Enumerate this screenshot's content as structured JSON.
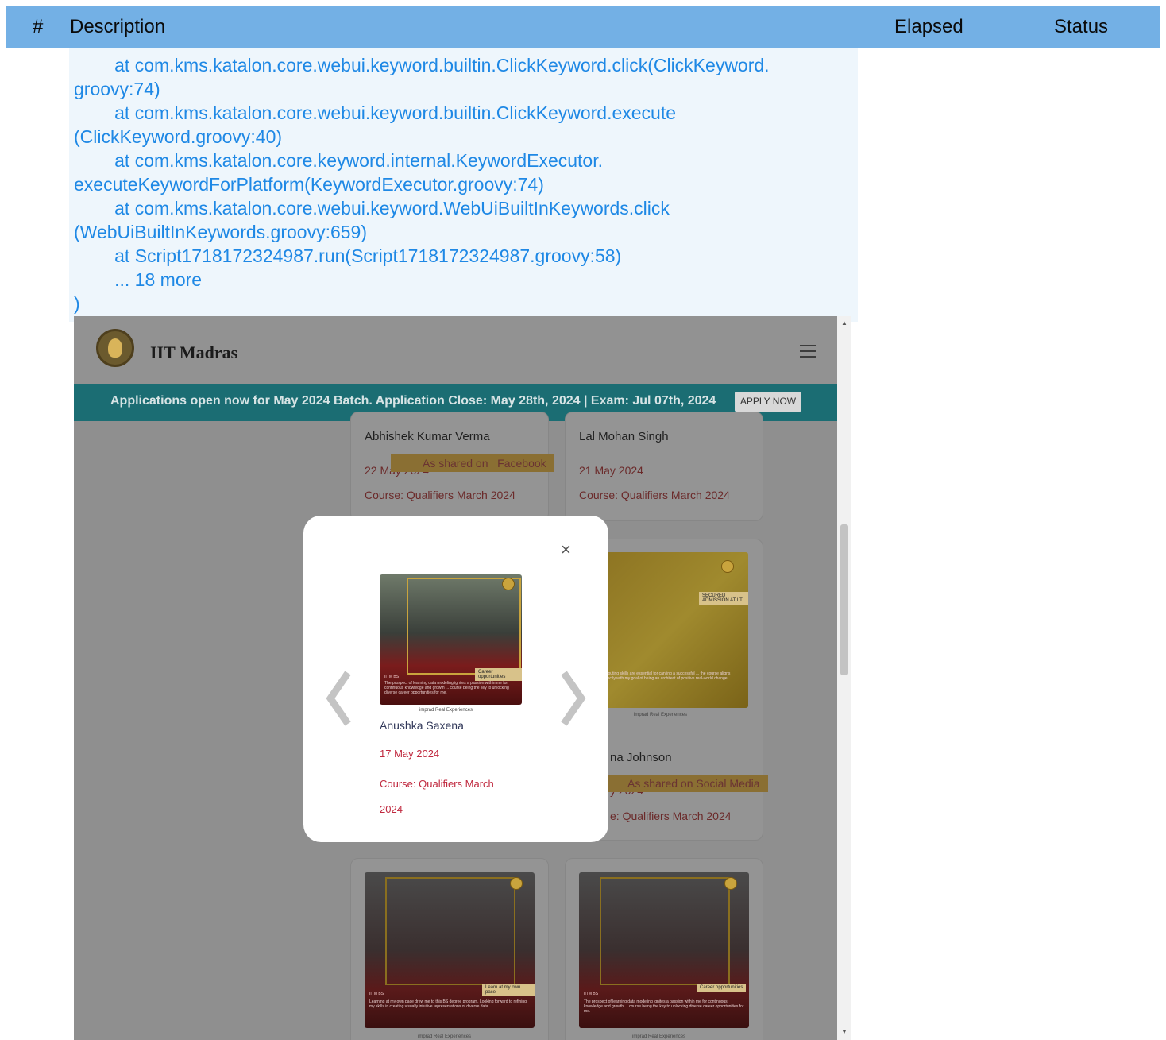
{
  "table_header": {
    "num": "#",
    "description": "Description",
    "elapsed": "Elapsed",
    "status": "Status"
  },
  "trace": [
    "        at com.kms.katalon.core.webui.keyword.builtin.ClickKeyword.click(ClickKeyword.",
    "groovy:74)",
    "        at com.kms.katalon.core.webui.keyword.builtin.ClickKeyword.execute",
    "(ClickKeyword.groovy:40)",
    "        at com.kms.katalon.core.keyword.internal.KeywordExecutor.",
    "executeKeywordForPlatform(KeywordExecutor.groovy:74)",
    "        at com.kms.katalon.core.webui.keyword.WebUiBuiltInKeywords.click",
    "(WebUiBuiltInKeywords.groovy:659)",
    "        at Script1718172324987.run(Script1718172324987.groovy:58)",
    "        ... 18 more",
    ")"
  ],
  "site": {
    "title": "IIT Madras",
    "banner_text": "Applications open now for May 2024 Batch. Application Close: May 28th, 2024 | Exam: Jul 07th, 2024",
    "apply_label": "APPLY NOW"
  },
  "cards": [
    {
      "name": "Abhishek Kumar Verma",
      "date": "22 May 2024",
      "course": "Course: Qualifiers March 2024",
      "ribbon": "As shared on   Facebook"
    },
    {
      "name": "Lal Mohan Singh",
      "date": "21 May 2024",
      "course": "Course: Qualifiers March 2024"
    },
    {
      "name_partial": "na Johnson",
      "date_partial": "y 2024",
      "course_partial": "e: Qualifiers March 2024",
      "ribbon": "As shared on Social Media"
    }
  ],
  "photo_texts": {
    "yellow_tag": "SECURED ADMISSION AT IIT",
    "yellow_caption": "computing skills are essential for carving a successful ... the course aligns perfectly with my goal of being an architect of positive real-world change.",
    "red1_tag": "Career opportunities",
    "red1_caption": "The prospect of learning data modeling ignites a passion within me for continuous knowledge and growth ... course being the key to unlocking diverse career opportunities for me.",
    "red2_tag": "Learn at my own pace",
    "red2_caption": "Learning at my own pace drew me to this BS degree program. Looking forward to refining my skills in creating visually intuitive representations of diverse data.",
    "brand": "imprad Real Experiences",
    "photo_label": "IITM BS"
  },
  "modal": {
    "close_label": "×",
    "name": "Anushka Saxena",
    "date": "17 May 2024",
    "course": "Course: Qualifiers March 2024"
  },
  "colors": {
    "header": "#73b0e5",
    "trace_text": "#1e88e5",
    "trace_bg": "#eef6fc",
    "modal_date": "#c0293f",
    "banner": "#1b6d73"
  }
}
